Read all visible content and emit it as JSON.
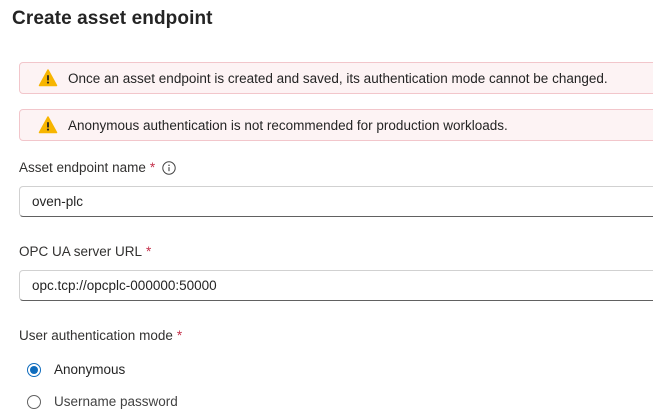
{
  "page": {
    "title": "Create asset endpoint"
  },
  "banners": [
    {
      "icon": "warning-icon",
      "text": "Once an asset endpoint is created and saved, its authentication mode cannot be changed."
    },
    {
      "icon": "warning-icon",
      "text": "Anonymous authentication is not recommended for production workloads."
    }
  ],
  "fields": {
    "name": {
      "label": "Asset endpoint name",
      "required_mark": "*",
      "value": "oven-plc"
    },
    "url": {
      "label": "OPC UA server URL",
      "required_mark": "*",
      "value": "opc.tcp://opcplc-000000:50000"
    }
  },
  "auth": {
    "label": "User authentication mode",
    "required_mark": "*",
    "options": [
      {
        "label": "Anonymous",
        "selected": true
      },
      {
        "label": "Username password",
        "selected": false
      }
    ]
  },
  "colors": {
    "warning_bg": "#fdf3f4",
    "warning_border": "#f2c6cb",
    "warning_icon": "#f7b500",
    "accent": "#0f6cbd",
    "required": "#c4314b"
  }
}
